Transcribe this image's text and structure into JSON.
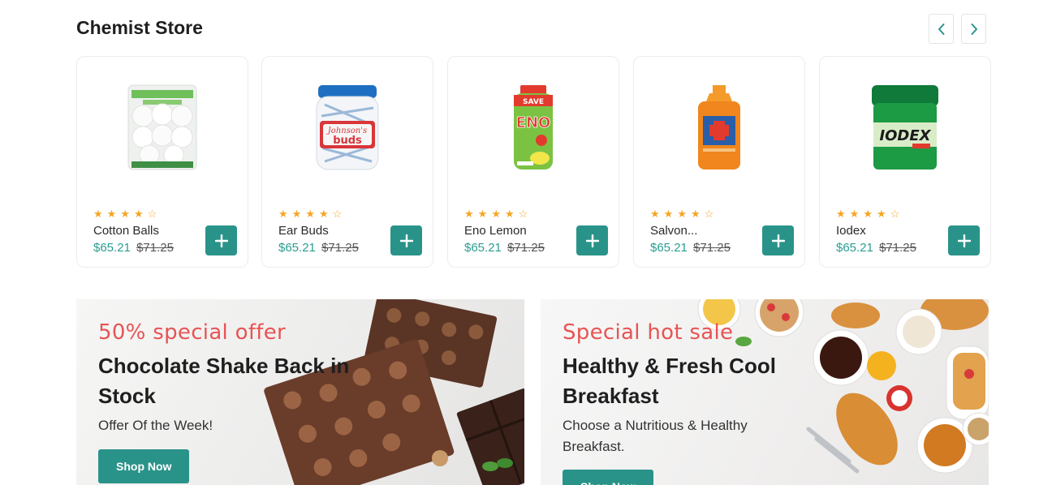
{
  "section": {
    "title": "Chemist Store",
    "nav_prev_icon": "chevron-left-icon",
    "nav_next_icon": "chevron-right-icon"
  },
  "products": [
    {
      "name": "Cotton Balls",
      "price": "$65.21",
      "old_price": "$71.25",
      "rating": 4,
      "rating_max": 5,
      "image": "cotton-balls-pack-icon"
    },
    {
      "name": "Ear Buds",
      "price": "$65.21",
      "old_price": "$71.25",
      "rating": 4,
      "rating_max": 5,
      "image": "ear-buds-jar-icon"
    },
    {
      "name": "Eno Lemon",
      "price": "$65.21",
      "old_price": "$71.25",
      "rating": 4,
      "rating_max": 5,
      "image": "eno-bottle-icon"
    },
    {
      "name": "Salvon...",
      "price": "$65.21",
      "old_price": "$71.25",
      "rating": 4,
      "rating_max": 5,
      "image": "antiseptic-bottle-icon"
    },
    {
      "name": "Iodex",
      "price": "$65.21",
      "old_price": "$71.25",
      "rating": 4,
      "rating_max": 5,
      "image": "balm-jar-icon"
    }
  ],
  "banners": [
    {
      "tag": "50% special offer",
      "title": "Chocolate Shake Back in Stock",
      "subtitle": "Offer Of the Week!",
      "button": "Shop Now"
    },
    {
      "tag": "Special hot sale",
      "title": "Healthy & Fresh Cool Breakfast",
      "subtitle": "Choose a Nutritious & Healthy Breakfast.",
      "button": "Shop Now"
    }
  ],
  "colors": {
    "accent": "#2a9389",
    "price": "#2a9d91",
    "tag": "#e75454",
    "star": "#f5a623"
  }
}
